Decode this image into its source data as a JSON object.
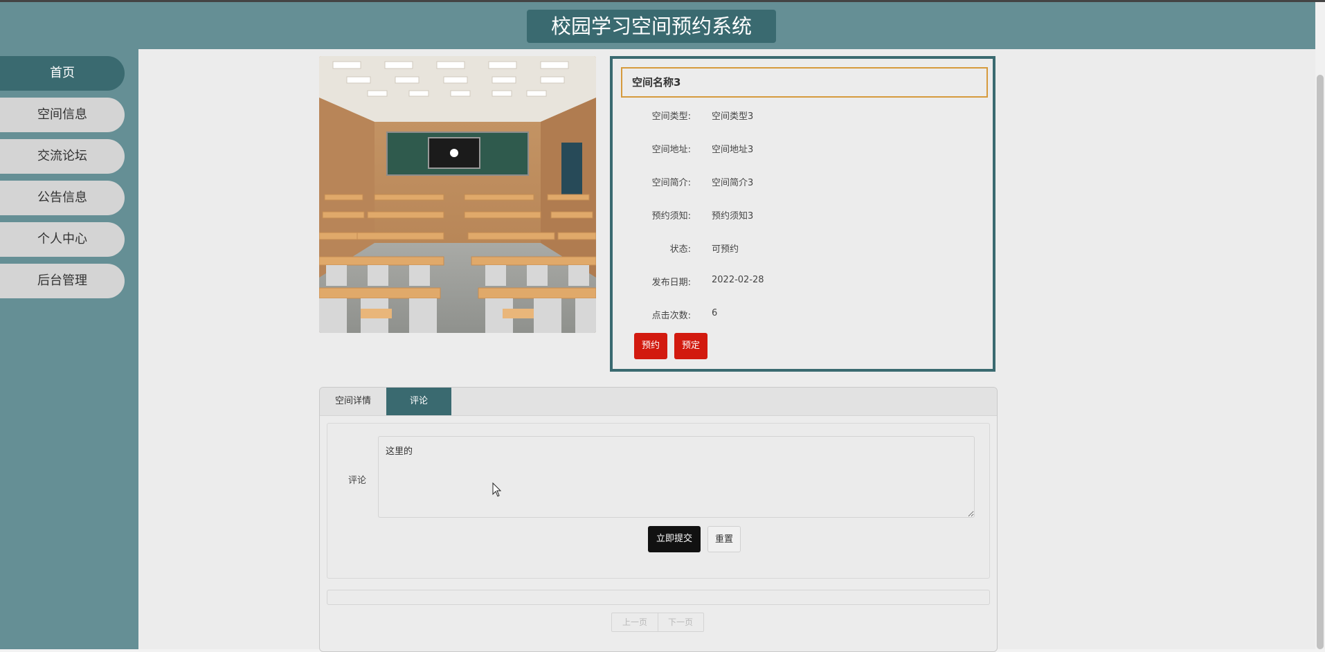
{
  "app": {
    "title": "校园学习空间预约系统"
  },
  "sidebar": {
    "items": [
      {
        "label": "首页",
        "active": true
      },
      {
        "label": "空间信息",
        "active": false
      },
      {
        "label": "交流论坛",
        "active": false
      },
      {
        "label": "公告信息",
        "active": false
      },
      {
        "label": "个人中心",
        "active": false
      },
      {
        "label": "后台管理",
        "active": false
      }
    ]
  },
  "detail": {
    "name": "空间名称3",
    "fields": [
      {
        "label": "空间类型:",
        "value": "空间类型3"
      },
      {
        "label": "空间地址:",
        "value": "空间地址3"
      },
      {
        "label": "空间简介:",
        "value": "空间简介3"
      },
      {
        "label": "预约须知:",
        "value": "预约须知3"
      },
      {
        "label": "状态:",
        "value": "可预约"
      },
      {
        "label": "发布日期:",
        "value": "2022-02-28"
      },
      {
        "label": "点击次数:",
        "value": "6"
      }
    ],
    "buttons": {
      "reserve": "预约",
      "book": "预定"
    }
  },
  "tabs": [
    {
      "label": "空间详情",
      "active": false
    },
    {
      "label": "评论",
      "active": true
    }
  ],
  "comment": {
    "label": "评论",
    "value": "这里的",
    "submit_label": "立即提交",
    "reset_label": "重置"
  },
  "pager": {
    "prev": "上一页",
    "next": "下一页"
  },
  "colors": {
    "teal": "#658f95",
    "dark_teal": "#3a6a70",
    "red": "#d21a0f",
    "orange_border": "#d69a3c"
  }
}
